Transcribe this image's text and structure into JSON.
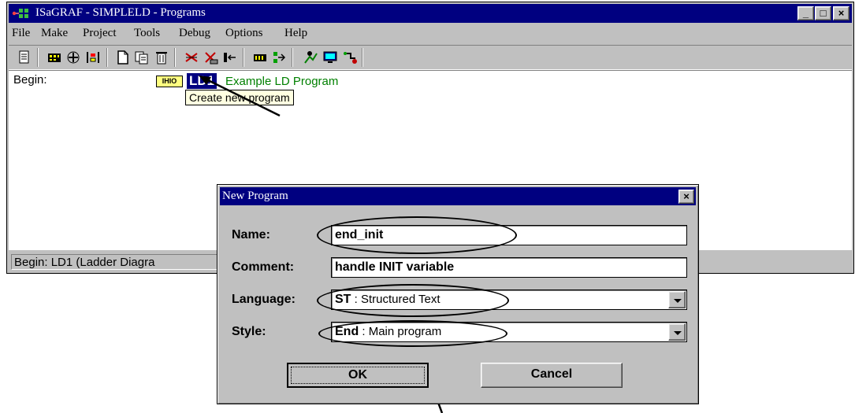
{
  "window": {
    "title": "ISaGRAF - SIMPLELD - Programs",
    "controls": {
      "minimize": "_",
      "maximize": "□",
      "close": "×"
    }
  },
  "menu": [
    "File",
    "Make",
    "Project",
    "Tools",
    "Debug",
    "Options",
    "Help"
  ],
  "toolbar_icons": [
    "page-icon",
    "box-grid-icon",
    "arrows-icon",
    "ladder-icon",
    "new-program-icon",
    "copy-icon",
    "delete-icon",
    "compile-icon",
    "verify-icon",
    "link-icon",
    "bus-icon",
    "io-icon",
    "simulate-icon",
    "monitor-icon",
    "run-icon"
  ],
  "workspace": {
    "section_label": "Begin:",
    "program_icon_text": "IHIO",
    "program_name": "LD1",
    "program_comment": "Example LD Program",
    "tooltip": "Create new program"
  },
  "statusbar": {
    "text": "Begin:  LD1   (Ladder Diagra"
  },
  "dialog": {
    "title": "New Program",
    "close": "×",
    "name_label": "Name:",
    "name_value": "end_init",
    "comment_label": "Comment:",
    "comment_value": "handle INIT variable",
    "language_label": "Language:",
    "language_code": "ST",
    "language_desc": " : Structured Text",
    "style_label": "Style:",
    "style_code": "End",
    "style_desc": " : Main program",
    "ok_label": "OK",
    "cancel_label": "Cancel"
  }
}
